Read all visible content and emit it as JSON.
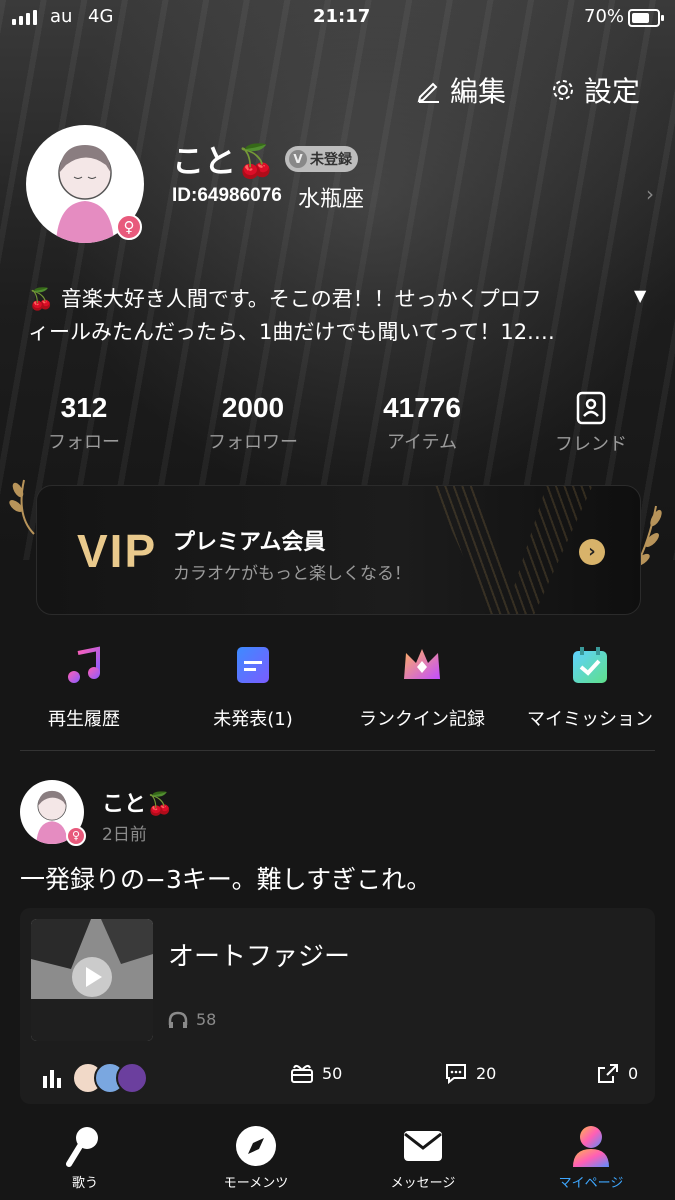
{
  "status_bar": {
    "carrier": "au",
    "network": "4G",
    "time": "21:17",
    "battery": "70%"
  },
  "header": {
    "edit_label": "編集",
    "settings_label": "設定"
  },
  "profile": {
    "name": "こと🍒",
    "badge": "未登録",
    "user_id": "ID:64986076",
    "zodiac": "水瓶座",
    "gender_symbol": "♀",
    "bio_line1": "🍒  音楽大好き人間です。そこの君！！せっかくプロフ",
    "bio_line2": "ィールみたんだったら、1曲だけでも聞いてって！12.…"
  },
  "stats": [
    {
      "value": "312",
      "label": "フォロー"
    },
    {
      "value": "2000",
      "label": "フォロワー"
    },
    {
      "value": "41776",
      "label": "アイテム"
    },
    {
      "label": "フレンド"
    }
  ],
  "vip": {
    "logo": "VIP",
    "title": "プレミアム会員",
    "subtitle": "カラオケがもっと楽しくなる！"
  },
  "quick_actions": [
    {
      "label": "再生履歴",
      "icon": "music-note-icon"
    },
    {
      "label": "未発表(1)",
      "icon": "document-icon"
    },
    {
      "label": "ランクイン記録",
      "icon": "crown-icon"
    },
    {
      "label": "マイミッション",
      "icon": "calendar-check-icon"
    }
  ],
  "post": {
    "author": "こと🍒",
    "time_ago": "2日前",
    "text": "一発録りの−3キー。難しすぎこれ。",
    "song_title": "オートファジー",
    "plays": "58",
    "gifts": "50",
    "comments": "20",
    "shares": "0"
  },
  "tabbar": [
    {
      "label": "歌う",
      "icon": "microphone-icon"
    },
    {
      "label": "モーメンツ",
      "icon": "compass-icon"
    },
    {
      "label": "メッセージ",
      "icon": "mail-icon"
    },
    {
      "label": "マイページ",
      "icon": "person-icon",
      "active": true
    }
  ],
  "colors": {
    "accent": "#3ea7ff",
    "gold": "#e9c98c",
    "female": "#e85a7c"
  }
}
